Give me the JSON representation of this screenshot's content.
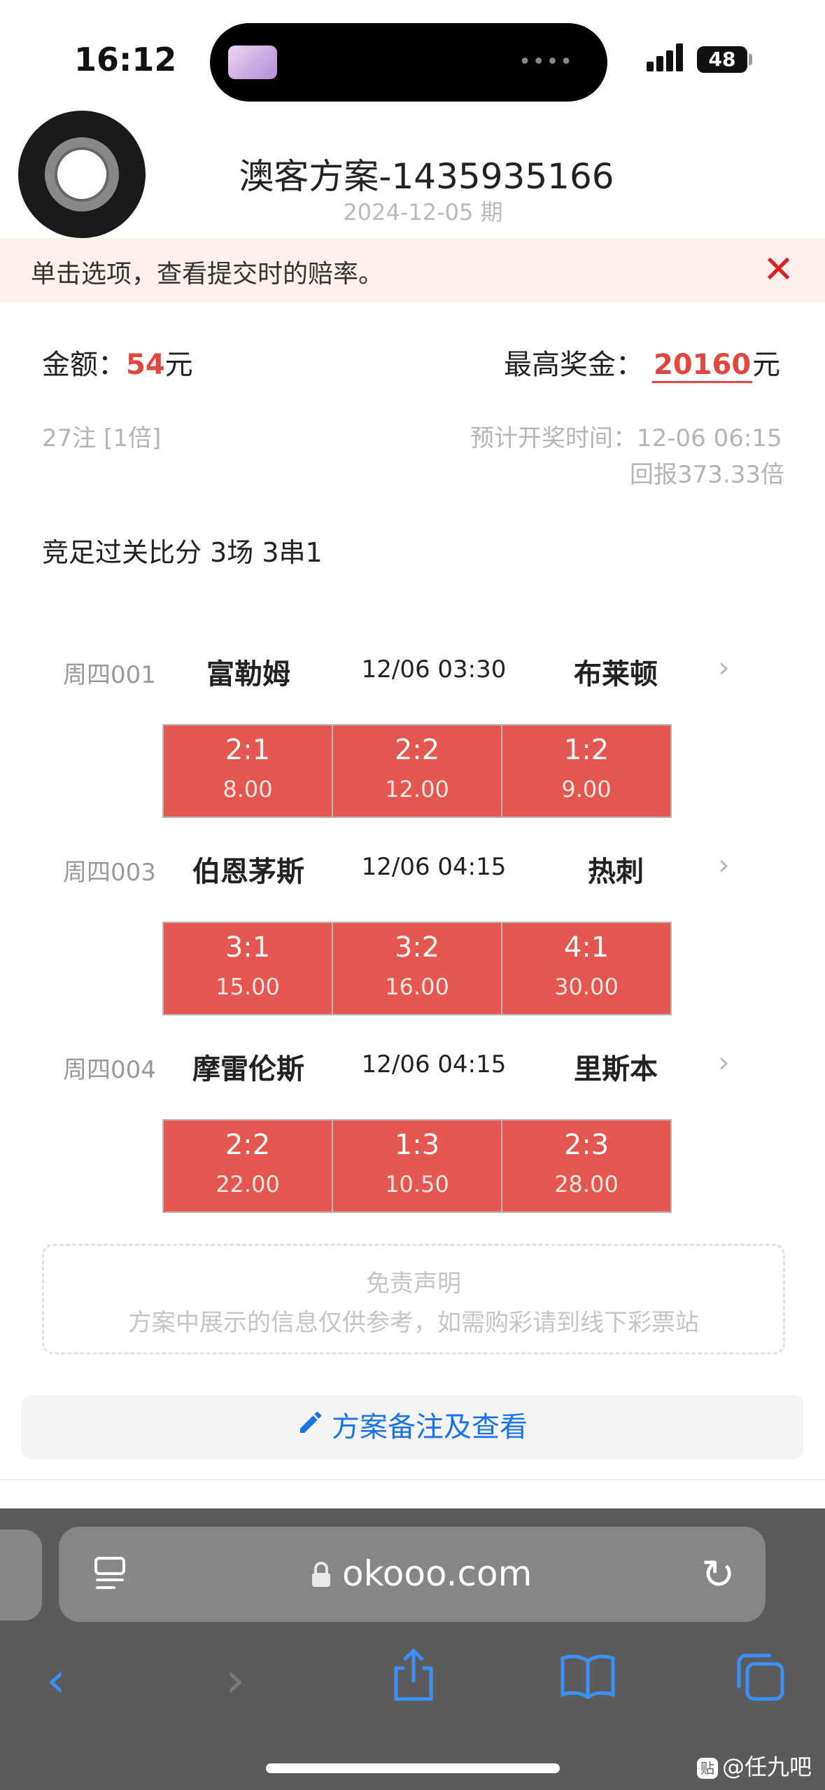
{
  "status_bar": {
    "time": "16:12",
    "battery": "48"
  },
  "header": {
    "title": "澳客方案-1435935166",
    "date": "2024-12-05 期"
  },
  "notice": {
    "text": "单击选项，查看提交时的赔率。"
  },
  "summary": {
    "amount_label": "金额：",
    "amount_value": "54",
    "amount_unit": "元",
    "prize_label": "最高奖金：",
    "prize_value": "20160",
    "prize_unit": "元",
    "bets": "27注 [1倍]",
    "draw_time": "预计开奖时间：12-06 06:15",
    "return_ratio": "回报373.33倍",
    "plan_type": "竞足过关比分 3场 3串1"
  },
  "matches": [
    {
      "code": "周四001",
      "home": "富勒姆",
      "time": "12/06 03:30",
      "away": "布莱顿",
      "picks": [
        {
          "score": "2:1",
          "odds": "8.00"
        },
        {
          "score": "2:2",
          "odds": "12.00"
        },
        {
          "score": "1:2",
          "odds": "9.00"
        }
      ]
    },
    {
      "code": "周四003",
      "home": "伯恩茅斯",
      "time": "12/06 04:15",
      "away": "热刺",
      "picks": [
        {
          "score": "3:1",
          "odds": "15.00"
        },
        {
          "score": "3:2",
          "odds": "16.00"
        },
        {
          "score": "4:1",
          "odds": "30.00"
        }
      ]
    },
    {
      "code": "周四004",
      "home": "摩雷伦斯",
      "time": "12/06 04:15",
      "away": "里斯本",
      "picks": [
        {
          "score": "2:2",
          "odds": "22.00"
        },
        {
          "score": "1:3",
          "odds": "10.50"
        },
        {
          "score": "2:3",
          "odds": "28.00"
        }
      ]
    }
  ],
  "disclaimer": {
    "title": "免责声明",
    "text": "方案中展示的信息仅供参考，如需购彩请到线下彩票站"
  },
  "notes_button": {
    "label": "方案备注及查看"
  },
  "browser": {
    "url": "okooo.com"
  },
  "watermark": {
    "text": "@任九吧",
    "badge": "贴"
  },
  "icons": {
    "close": "close-icon",
    "arrow": "chevron-right-icon",
    "pen": "pencil-icon",
    "lock": "lock-icon",
    "reload": "reload-icon",
    "back": "back-icon",
    "forward": "forward-icon",
    "share": "share-icon",
    "bookmarks": "bookmarks-icon",
    "tabs": "tabs-icon",
    "reader": "reader-icon"
  },
  "colors": {
    "accent_red": "#e4564f",
    "link_blue": "#1a73e8",
    "notice_bg": "#fdf0ef"
  }
}
